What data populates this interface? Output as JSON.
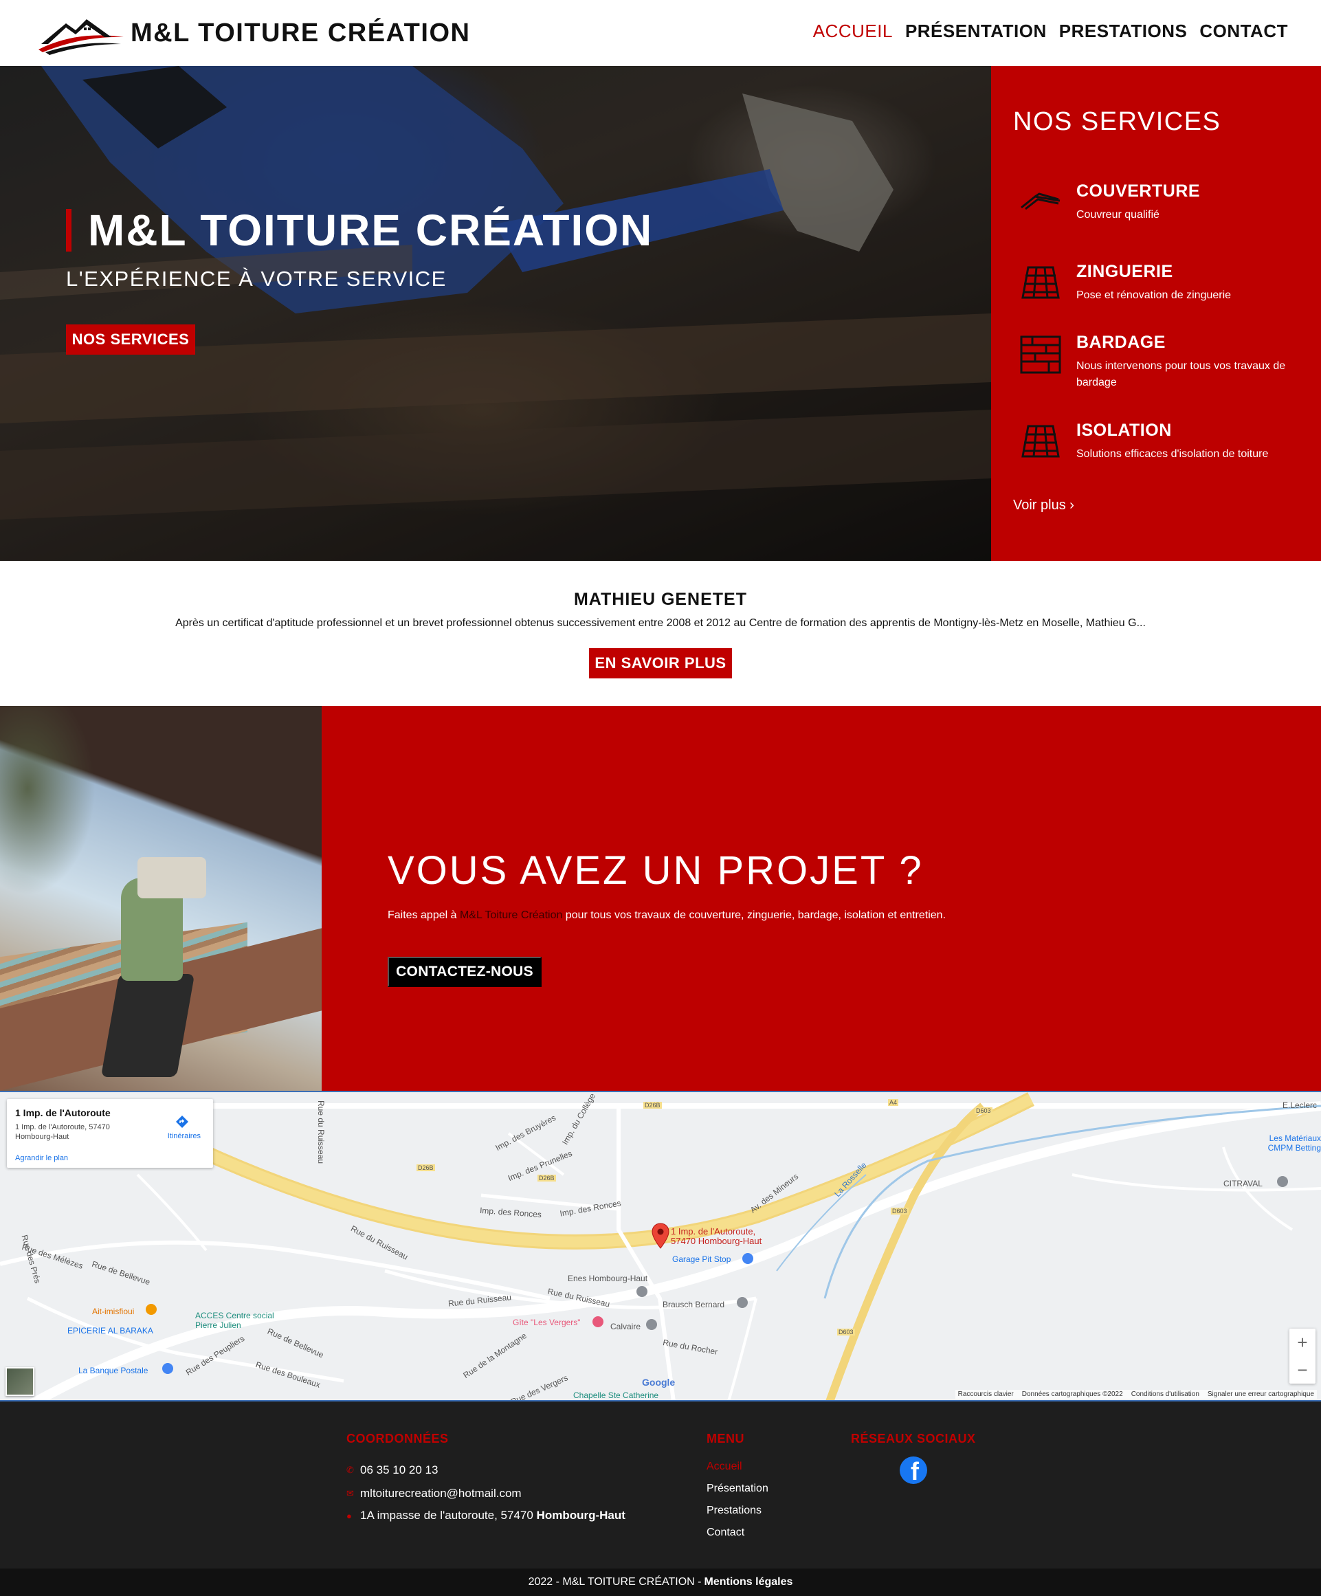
{
  "brand": {
    "name": "M&L TOITURE CRÉATION"
  },
  "nav": {
    "items": [
      {
        "label": "ACCUEIL"
      },
      {
        "label": "PRÉSENTATION"
      },
      {
        "label": "PRESTATIONS"
      },
      {
        "label": "CONTACT"
      }
    ]
  },
  "hero": {
    "title": "M&L TOITURE CRÉATION",
    "subtitle": "L'EXPÉRIENCE À VOTRE SERVICE",
    "button": "NOS SERVICES"
  },
  "services": {
    "heading": "NOS SERVICES",
    "items": [
      {
        "title": "COUVERTURE",
        "desc": "Couvreur qualifié",
        "icon": "roof-icon"
      },
      {
        "title": "ZINGUERIE",
        "desc": "Pose et rénovation de zinguerie",
        "icon": "tiles-icon"
      },
      {
        "title": "BARDAGE",
        "desc": "Nous intervenons pour tous vos travaux de bardage",
        "icon": "cladding-icon"
      },
      {
        "title": "ISOLATION",
        "desc": "Solutions efficaces d'isolation de toiture",
        "icon": "insulation-icon"
      }
    ],
    "more": "Voir plus"
  },
  "about": {
    "name": "MATHIEU GENETET",
    "text": "Après un certificat d'aptitude professionnel et un brevet professionnel obtenus successivement entre 2008 et 2012 au Centre de formation des apprentis de Montigny-lès-Metz en Moselle, Mathieu G...",
    "button": "EN SAVOIR PLUS"
  },
  "project": {
    "title": "VOUS AVEZ UN PROJET ?",
    "text_before": "Faites appel à ",
    "text_highlight": "M&L Toiture Création",
    "text_after": " pour tous vos travaux de couverture, zinguerie, bardage, isolation et entretien.",
    "button": "CONTACTEZ-NOUS"
  },
  "map": {
    "card_title": "1 Imp. de l'Autoroute",
    "card_address": "1 Imp. de l'Autoroute, 57470 Hombourg-Haut",
    "card_enlarge": "Agrandir le plan",
    "card_directions": "Itinéraires",
    "pin_label": "1 Imp. de l'Autoroute, 57470 Hombourg-Haut",
    "labels": {
      "ruisseau_top": "Rue du Ruisseau",
      "bruyeres": "Imp. des Bruyères",
      "college": "Imp. du Collège",
      "prunelles": "Imp. des Prunelles",
      "ronces1": "Imp. des Ronces",
      "ronces2": "Imp. des Ronces",
      "ruisseau_mid": "Rue du Ruisseau",
      "ruisseau_low": "Rue du Ruisseau",
      "ruisseau_low2": "Rue du Ruisseau",
      "mineurs": "Av. des Mineurs",
      "rosselle": "La Rosselle",
      "pres": "Rue des Prés",
      "melezes": "Rue des Mélèzes",
      "bellevue1": "Rue de Bellevue",
      "bellevue2": "Rue de Bellevue",
      "peupliers": "Rue des Peupliers",
      "bouleaux": "Rue des Bouleaux",
      "montagne": "Rue de la Montagne",
      "rocher": "Rue du Rocher",
      "vergers": "Rue des Vergers",
      "d26b_1": "D26B",
      "d26b_2": "D26B",
      "d26b_3": "D26B",
      "a4": "A4",
      "d603_1": "D603",
      "d603_2": "D603",
      "d603_3": "D603"
    },
    "pois": {
      "leclerc": "E.Leclerc",
      "materiaux": "Les Matériaux CMPM Betting",
      "citraval": "CITRAVAL",
      "garage": "Garage Pit Stop",
      "enes": "Enes Hombourg-Haut",
      "brausch": "Brausch Bernard",
      "gite": "Gîte \"Les Vergers\"",
      "calvaire": "Calvaire",
      "chapelle": "Chapelle Ste Catherine",
      "aitmisfioui": "Ait-imisfioui",
      "acces": "ACCES Centre social Pierre Julien",
      "epicerie": "EPICERIE AL BARAKA",
      "banque": "La Banque Postale"
    },
    "google": "Google",
    "attribution": [
      "Raccourcis clavier",
      "Données cartographiques ©2022",
      "Conditions d'utilisation",
      "Signaler une erreur cartographique"
    ]
  },
  "footer": {
    "coords_heading": "COORDONNÉES",
    "phone": "06 35 10 20 13",
    "email": "mltoiturecreation@hotmail.com",
    "address_street": "1A impasse de l'autoroute, 57470 ",
    "address_city": "Hombourg-Haut",
    "menu_heading": "MENU",
    "menu": [
      "Accueil",
      "Présentation",
      "Prestations",
      "Contact"
    ],
    "social_heading": "RÉSEAUX SOCIAUX",
    "copyright": "2022 - M&L TOITURE CRÉATION -",
    "legal": "Mentions légales"
  },
  "colors": {
    "accent": "#c00000",
    "panel": "#bd0000",
    "footer": "#1e1e1e"
  }
}
